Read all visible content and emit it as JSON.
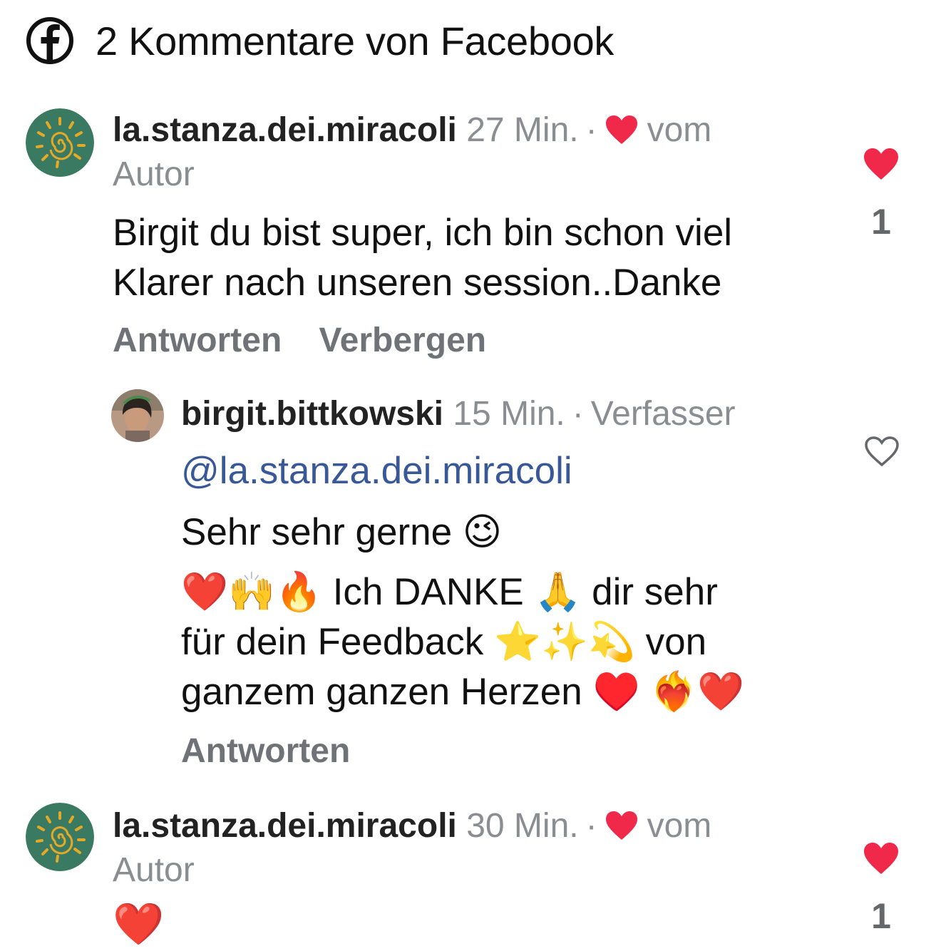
{
  "header": {
    "icon": "facebook-icon",
    "title": "2 Kommentare von Facebook"
  },
  "comments": [
    {
      "username": "la.stanza.dei.miracoli",
      "time": "27 Min.",
      "author_badge_line1": "vom",
      "author_badge_line2": "Autor",
      "text_line1": "Birgit du bist super, ich bin schon viel",
      "text_line2": "Klarer nach unseren session..Danke",
      "action_reply": "Antworten",
      "action_hide": "Verbergen",
      "liked": true,
      "like_count": "1",
      "reply": {
        "username": "birgit.bittkowski",
        "time": "15 Min.",
        "role": "Verfasser",
        "mention": "@la.stanza.dei.miracoli",
        "line1": "Sehr sehr gerne 😉",
        "line2": "❤️🙌🔥 Ich DANKE 🙏 dir sehr",
        "line3": "für dein Feedback ⭐✨💫 von",
        "line4": "ganzem ganzen Herzen ♥️ ❤️‍🔥❤️",
        "action_reply": "Antworten",
        "liked": false
      }
    },
    {
      "username": "la.stanza.dei.miracoli",
      "time": "30 Min.",
      "author_badge_line1": "vom",
      "author_badge_line2": "Autor",
      "text": "❤️",
      "liked": true,
      "like_count": "1"
    }
  ],
  "colors": {
    "like_red": "#f02849",
    "mention_blue": "#385898",
    "meta_grey": "#8a8d91"
  }
}
